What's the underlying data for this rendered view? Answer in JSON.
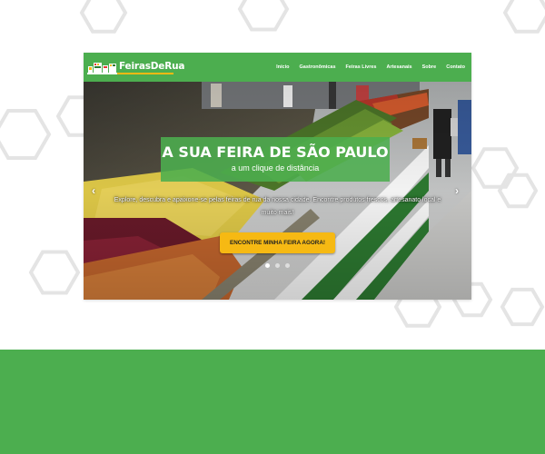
{
  "colors": {
    "brand_green": "#4cae4f",
    "bottom_band": "#4cae4f",
    "hexagon_outline": "#e4e4e4",
    "title_overlay": "rgba(76,174,79,0.88)",
    "cta_yellow": "#f6b913",
    "logo_underline": "#f6b913",
    "dot_active": "#ffffff",
    "dot_inactive": "rgba(255,255,255,0.55)"
  },
  "header": {
    "logo_text": "FeirasDeRua",
    "logo_icon": "market-stall-icon",
    "nav": [
      {
        "label": "Início"
      },
      {
        "label": "Gastronômicas"
      },
      {
        "label": "Feiras Livres"
      },
      {
        "label": "Artesanais"
      },
      {
        "label": "Sobre"
      },
      {
        "label": "Contato"
      }
    ]
  },
  "hero": {
    "title": "A SUA FEIRA DE SÃO PAULO",
    "subtitle": "a um clique de distância",
    "description": "Explore, descubra e apaixone-se pelas feiras de rua da nossa cidade. Encontre produtos frescos, artesanato local e muito mais!",
    "cta": "ENCONTRE MINHA FEIRA AGORA!",
    "prev_icon": "chevron-left-icon",
    "next_icon": "chevron-right-icon",
    "prev_glyph": "‹",
    "next_glyph": "›",
    "slides_total": 3,
    "active_slide": 1
  }
}
